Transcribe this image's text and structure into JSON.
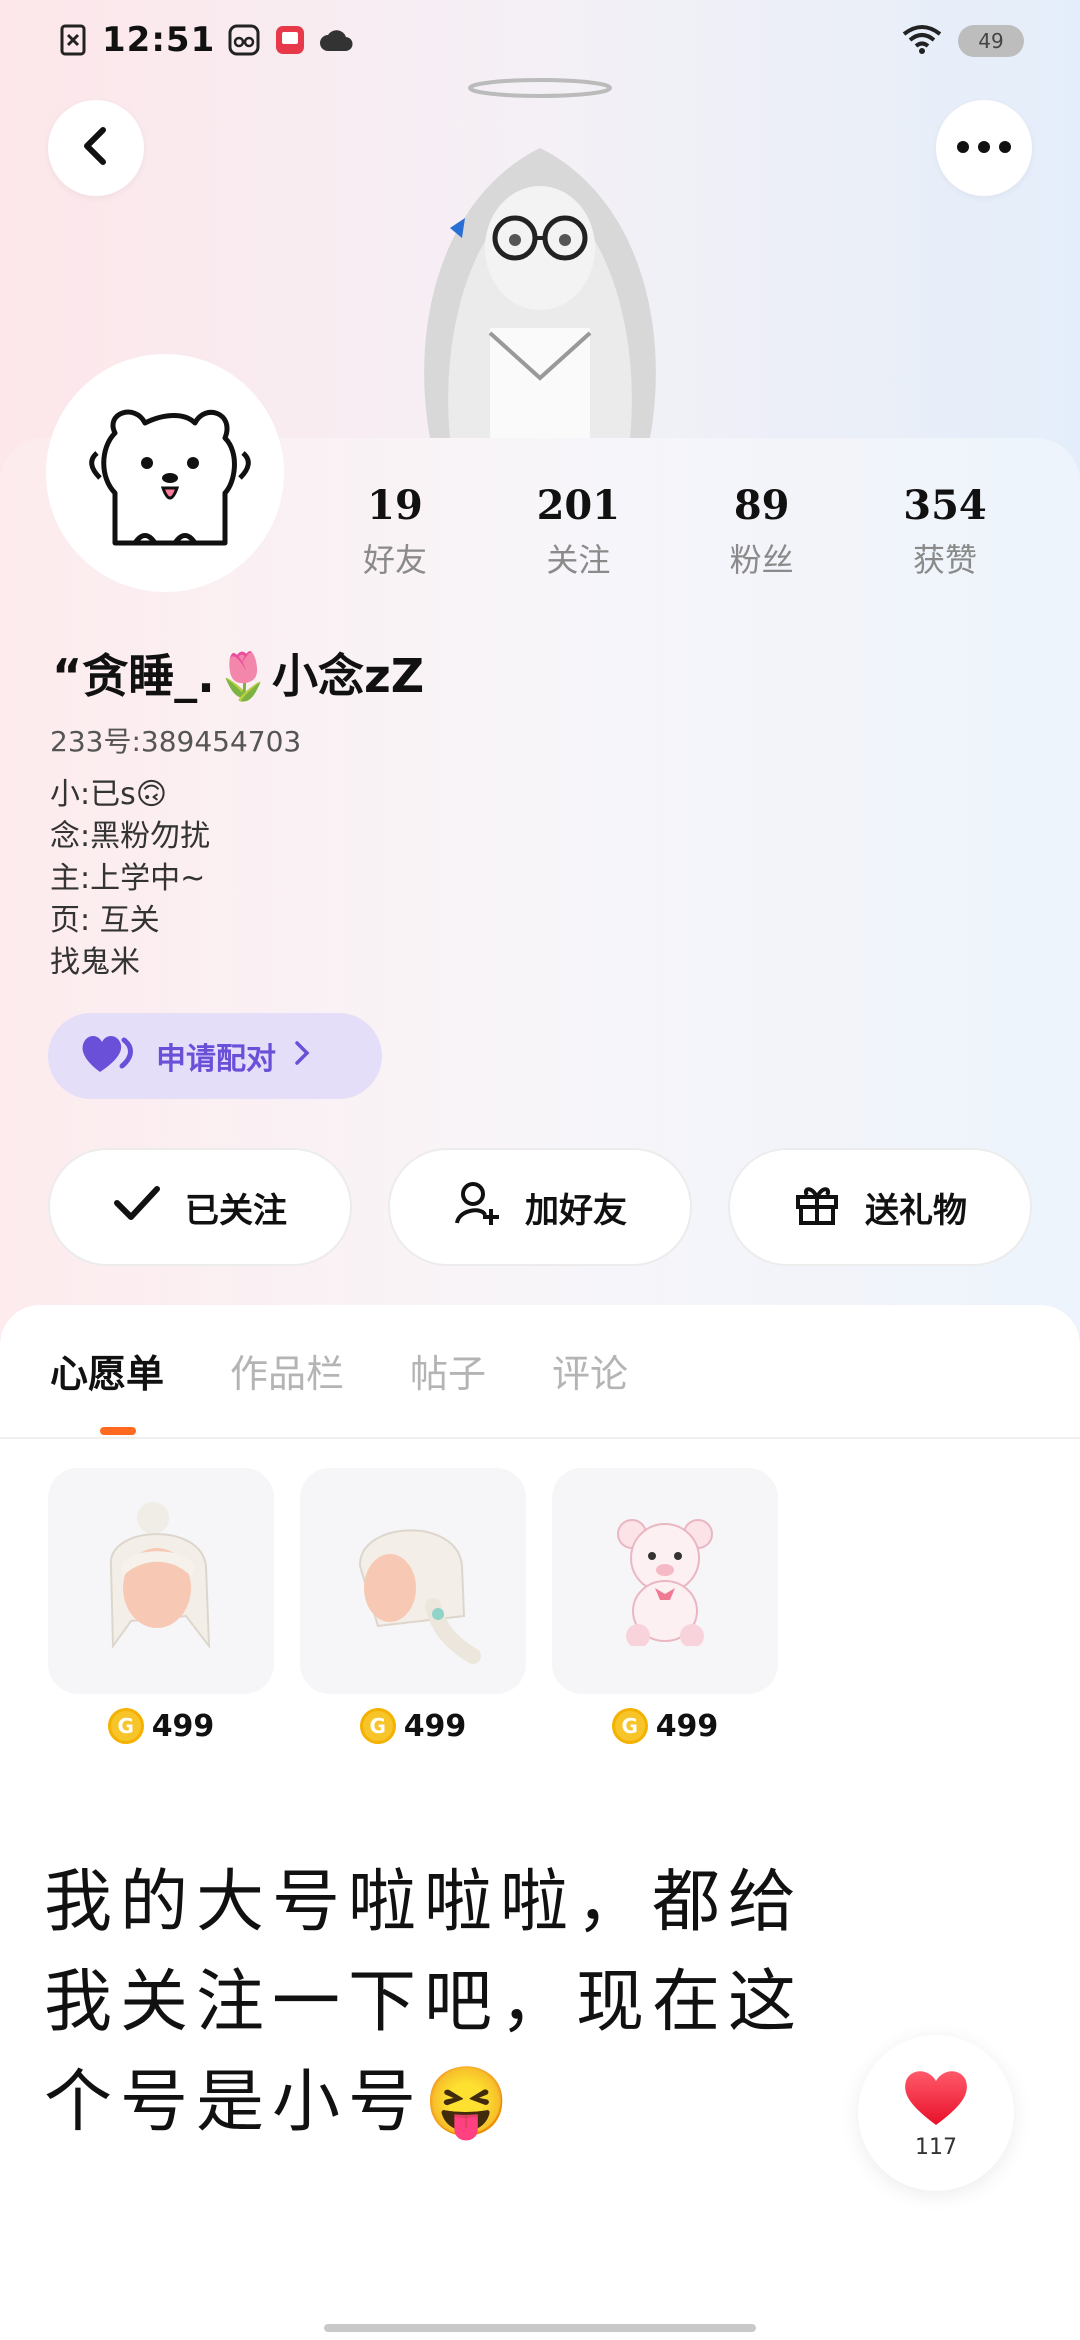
{
  "status_bar": {
    "time": "12:51",
    "battery": "49",
    "icons": [
      "no-sim-icon",
      "app-icon",
      "app-icon",
      "cloud-icon",
      "wifi-icon",
      "battery-icon"
    ]
  },
  "header": {
    "back_icon": "chevron-left-icon",
    "more_icon": "more-horizontal-icon"
  },
  "profile": {
    "username": "“贪睡_.🌷小念zZ",
    "id_line": "233号:389454703",
    "bio": [
      "小:已s🙃",
      "念:黑粉勿扰",
      "主:上学中~",
      "页: 互关",
      "找鬼米"
    ],
    "stats": [
      {
        "value": "19",
        "label": "好友"
      },
      {
        "value": "201",
        "label": "关注"
      },
      {
        "value": "89",
        "label": "粉丝"
      },
      {
        "value": "354",
        "label": "获赞"
      }
    ],
    "match_label": "申请配对",
    "actions": [
      {
        "label": "已关注",
        "icon": "check-icon"
      },
      {
        "label": "加好友",
        "icon": "add-friend-icon"
      },
      {
        "label": "送礼物",
        "icon": "gift-icon"
      }
    ]
  },
  "tabs": [
    "心愿单",
    "作品栏",
    "帖子",
    "评论"
  ],
  "wishlist": [
    {
      "price": "499",
      "item": "white-bun-hairstyle"
    },
    {
      "price": "499",
      "item": "white-braid-hairstyle"
    },
    {
      "price": "499",
      "item": "pink-teddy-bear"
    }
  ],
  "post": {
    "text": "我的大号啦啦啦，都给我关注一下吧，现在这个号是小号😝"
  },
  "like": {
    "count": "117"
  },
  "colors": {
    "accent": "#ff6a1f",
    "match": "#6a4fd8",
    "coin": "#f7c429"
  }
}
